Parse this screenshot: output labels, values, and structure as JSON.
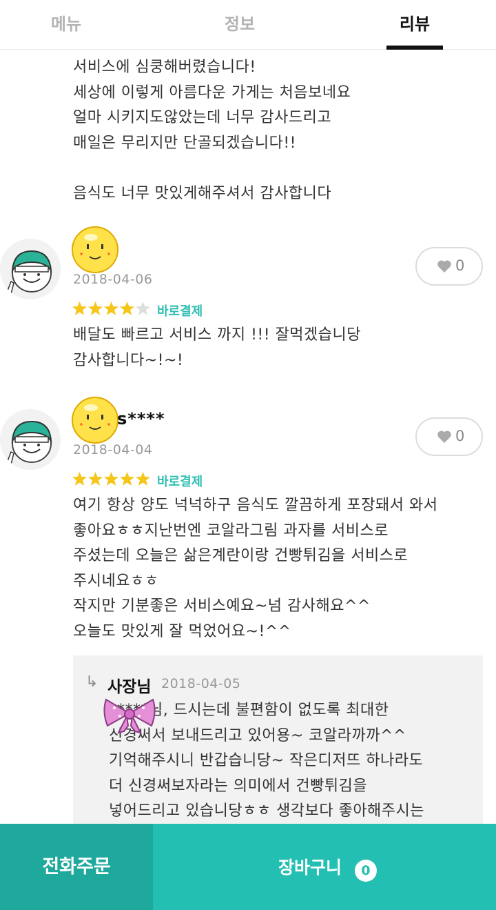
{
  "tabs": [
    {
      "label": "메뉴",
      "active": false
    },
    {
      "label": "정보",
      "active": false
    },
    {
      "label": "리뷰",
      "active": true
    }
  ],
  "first_review_tail": "서비스에 심쿵해버렸습니다!\n세상에 이렇게 아름다운 가게는 처음보네요\n얼마 시키지도않았는데 너무 감사드리고\n매일은 무리지만 단골되겠습니다!!\n\n음식도 너무 맛있게해주셔서 감사합니다",
  "reviews": [
    {
      "name": "",
      "date": "2018-04-06",
      "rating": 4,
      "rating_max": 5,
      "payment_tag": "바로결제",
      "likes": "0",
      "text": "배달도 빠르고 서비스 까지 !!! 잘먹겠습니당\n감사합니다~!~!"
    },
    {
      "name": "s****",
      "date": "2018-04-04",
      "rating": 5,
      "rating_max": 5,
      "payment_tag": "바로결제",
      "likes": "0",
      "text": "여기 항상 양도 넉넉하구 음식도 깔끔하게 포장돼서 와서\n좋아요ㅎㅎ지난번엔 코알라그림 과자를 서비스로\n주셨는데 오늘은 삶은계란이랑 건빵튀김을 서비스로\n주시네요ㅎㅎ\n작지만 기분좋은 서비스예요~넘 감사해요^^\n오늘도 맛있게 잘 먹었어요~!^^",
      "reply": {
        "arrow": "↳",
        "author": "사장님",
        "date": "2018-04-05",
        "text": "        s****님, 드시는데 불편함이 없도록 최대한\n신경써서 보내드리고 있어용~ 코알라까까^^\n기억해주시니 반갑습니당~ 작은디저뜨 하나라도\n더 신경써보자라는 의미에서 건빵튀김을\n넣어드리고 있습니당ㅎㅎ 생각보다 좋아해주시는"
      }
    }
  ],
  "bottom_bar": {
    "phone_order_label": "전화주문",
    "cart_label": "장바구니",
    "cart_count": "0"
  },
  "colors": {
    "accent": "#23bfb2",
    "accent_dark": "#1fa99d",
    "star": "#f5c518",
    "star_empty": "#dddddd"
  },
  "icons": [
    "emoji-face-icon",
    "helmet-character-avatar",
    "heart-icon",
    "star-icon",
    "ribbon-icon",
    "reply-arrow-icon"
  ]
}
